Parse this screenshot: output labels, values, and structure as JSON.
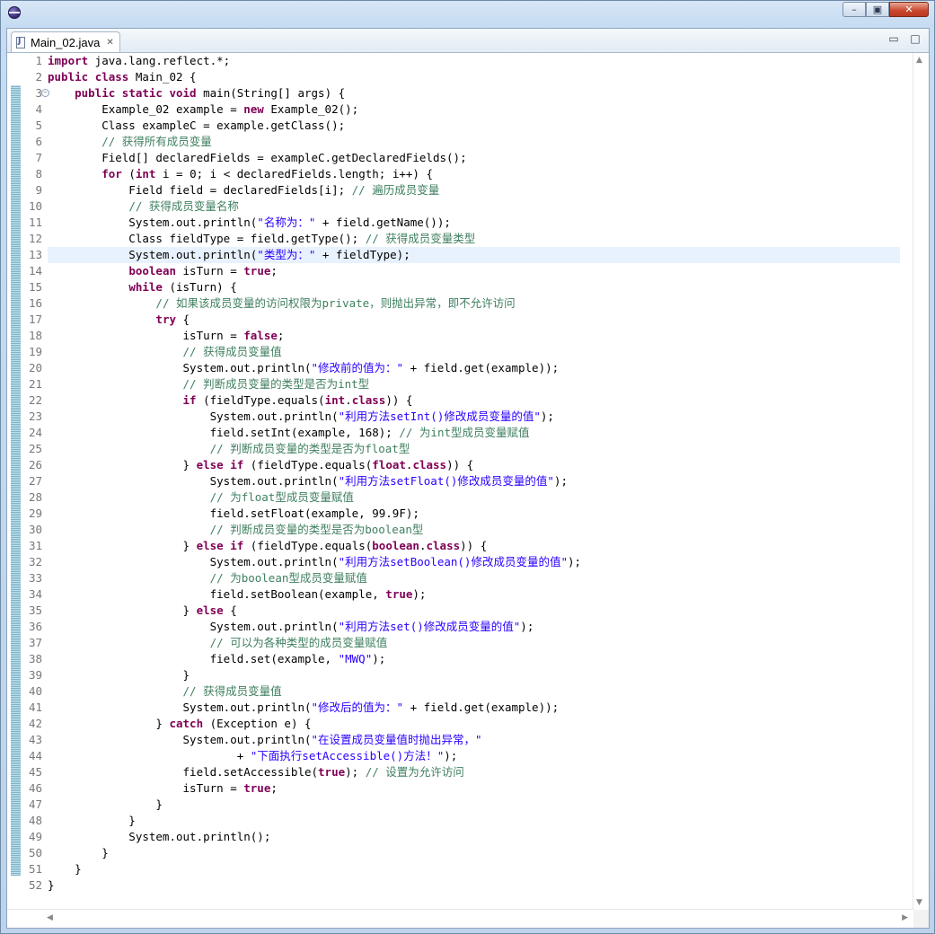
{
  "editor": {
    "tab_label": "Main_02.java",
    "tab_close_glyph": "✕",
    "minimize_glyph": "▭",
    "maximize_glyph": "□"
  },
  "window": {
    "min_glyph": "–",
    "restore_glyph": "▣",
    "close_glyph": "✕"
  },
  "code": {
    "current_line": 13,
    "lines": [
      "import java.lang.reflect.*;",
      "public class Main_02 {",
      "    public static void main(String[] args) {",
      "        Example_02 example = new Example_02();",
      "        Class exampleC = example.getClass();",
      "        // 获得所有成员变量",
      "        Field[] declaredFields = exampleC.getDeclaredFields();",
      "        for (int i = 0; i < declaredFields.length; i++) {",
      "            Field field = declaredFields[i]; // 遍历成员变量",
      "            // 获得成员变量名称",
      "            System.out.println(\"名称为：\" + field.getName());",
      "            Class fieldType = field.getType(); // 获得成员变量类型",
      "            System.out.println(\"类型为：\" + fieldType);",
      "            boolean isTurn = true;",
      "            while (isTurn) {",
      "                // 如果该成员变量的访问权限为private，则抛出异常，即不允许访问",
      "                try {",
      "                    isTurn = false;",
      "                    // 获得成员变量值",
      "                    System.out.println(\"修改前的值为：\" + field.get(example));",
      "                    // 判断成员变量的类型是否为int型",
      "                    if (fieldType.equals(int.class)) {",
      "                        System.out.println(\"利用方法setInt()修改成员变量的值\");",
      "                        field.setInt(example, 168); // 为int型成员变量赋值",
      "                        // 判断成员变量的类型是否为float型",
      "                    } else if (fieldType.equals(float.class)) {",
      "                        System.out.println(\"利用方法setFloat()修改成员变量的值\");",
      "                        // 为float型成员变量赋值",
      "                        field.setFloat(example, 99.9F);",
      "                        // 判断成员变量的类型是否为boolean型",
      "                    } else if (fieldType.equals(boolean.class)) {",
      "                        System.out.println(\"利用方法setBoolean()修改成员变量的值\");",
      "                        // 为boolean型成员变量赋值",
      "                        field.setBoolean(example, true);",
      "                    } else {",
      "                        System.out.println(\"利用方法set()修改成员变量的值\");",
      "                        // 可以为各种类型的成员变量赋值",
      "                        field.set(example, \"MWQ\");",
      "                    }",
      "                    // 获得成员变量值",
      "                    System.out.println(\"修改后的值为：\" + field.get(example));",
      "                } catch (Exception e) {",
      "                    System.out.println(\"在设置成员变量值时抛出异常，\"",
      "                            + \"下面执行setAccessible()方法！\");",
      "                    field.setAccessible(true); // 设置为允许访问",
      "                    isTurn = true;",
      "                }",
      "            }",
      "            System.out.println();",
      "        }",
      "    }",
      "}"
    ]
  }
}
